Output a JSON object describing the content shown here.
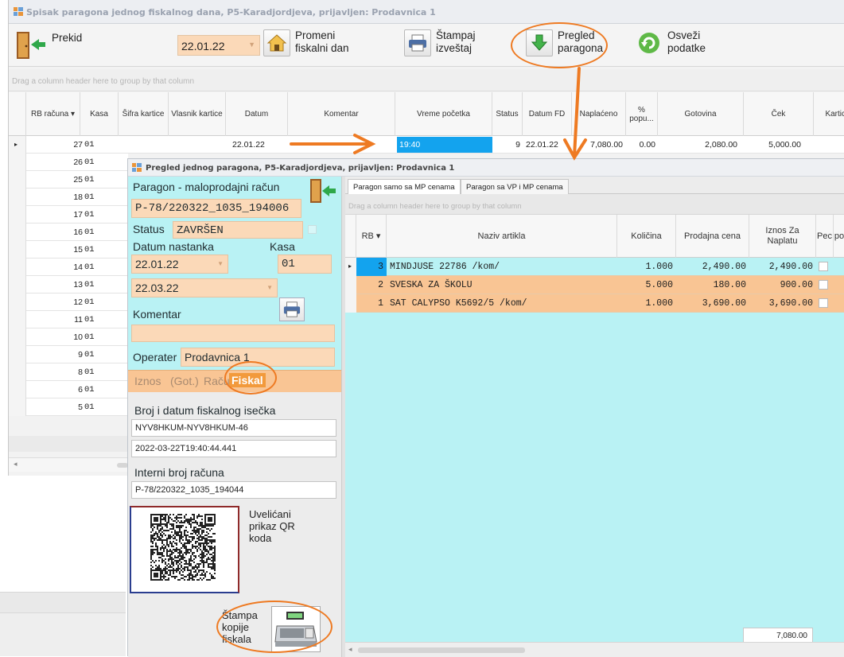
{
  "main_window": {
    "title": "Spisak paragona jednog fiskalnog dana, P5-Karadjordjeva, prijavljen: Prodavnica 1",
    "toolbar": {
      "prekid": "Prekid",
      "date": "22.01.22",
      "promeni_l1": "Promeni",
      "promeni_l2": "fiskalni dan",
      "stampaj_l1": "Štampaj",
      "stampaj_l2": "izveštaj",
      "pregled_l1": "Pregled",
      "pregled_l2": "paragona",
      "osvezi_l1": "Osveži",
      "osvezi_l2": "podatke"
    },
    "group_hint": "Drag a column header here to group by that column",
    "columns": {
      "rb": "RB računa",
      "kasa": "Kasa",
      "sifra": "Šifra kartice",
      "vlasnik": "Vlasnik kartice",
      "datum": "Datum",
      "komentar": "Komentar",
      "vreme": "Vreme početka",
      "status": "Status",
      "datum_fd": "Datum FD",
      "naplaceno": "Naplaćeno",
      "popust": "% popu...",
      "gotovina": "Gotovina",
      "cek": "Ček",
      "kartica": "Kartica"
    },
    "selected_row": {
      "rb": "27",
      "kasa": "01",
      "datum": "22.01.22",
      "vreme": "19:40",
      "status": "9",
      "datum_fd": "22.01.22",
      "naplaceno": "7,080.00",
      "popust": "0.00",
      "gotovina": "2,080.00",
      "cek": "5,000.00"
    },
    "rows": [
      {
        "rb": "26",
        "kasa": "01"
      },
      {
        "rb": "25",
        "kasa": "01"
      },
      {
        "rb": "18",
        "kasa": "01"
      },
      {
        "rb": "17",
        "kasa": "01"
      },
      {
        "rb": "16",
        "kasa": "01"
      },
      {
        "rb": "15",
        "kasa": "01"
      },
      {
        "rb": "14",
        "kasa": "01"
      },
      {
        "rb": "13",
        "kasa": "01"
      },
      {
        "rb": "12",
        "kasa": "01"
      },
      {
        "rb": "11",
        "kasa": "01"
      },
      {
        "rb": "10",
        "kasa": "01"
      },
      {
        "rb": "9",
        "kasa": "01"
      },
      {
        "rb": "8",
        "kasa": "01"
      },
      {
        "rb": "6",
        "kasa": "01"
      },
      {
        "rb": "5",
        "kasa": "01"
      }
    ]
  },
  "dialog": {
    "title": "Pregled jednog paragona, P5-Karadjordjeva, prijavljen: Prodavnica 1",
    "paragon_label": "Paragon - maloprodajni račun",
    "paragon_no": "P-78/220322_1035_194006",
    "status_label": "Status",
    "status_value": "ZAVRŠEN",
    "datum_nastanka_label": "Datum nastanka",
    "kasa_label": "Kasa",
    "datum1": "22.01.22",
    "kasa_value": "01",
    "datum2": "22.03.22",
    "komentar_label": "Komentar",
    "operater_label": "Operater",
    "operater_value": "Prodavnica 1",
    "tabs": {
      "iznos": "Iznos",
      "got": "(Got.)",
      "racun": "Račun",
      "fiskal": "Fiskal"
    },
    "broj_datum_label": "Broj i datum fiskalnog isečka",
    "fiskal_broj": "NYV8HKUM-NYV8HKUM-46",
    "fiskal_datum": "2022-03-22T19:40:44.441",
    "interni_label": "Interni broj računa",
    "interni_value": "P-78/220322_1035_194044",
    "qr_caption": "Uvelićani prikaz QR koda",
    "stampa_l1": "Štampa",
    "stampa_l2": "kopije",
    "stampa_l3": "fiskala",
    "right": {
      "tab1": "Paragon samo sa MP cenama",
      "tab2": "Paragon sa VP i MP cenama",
      "group_hint": "Drag a column header here to group by that column",
      "columns": {
        "rb": "RB",
        "naziv": "Naziv artikla",
        "kolicina": "Količina",
        "prodajna": "Prodajna cena",
        "iznos": "Iznos Za Naplatu",
        "pec": "Pec"
      },
      "items": [
        {
          "rb": "3",
          "naziv": "MINDJUSE 22786 /kom/",
          "kolicina": "1.000",
          "cena": "2,490.00",
          "iznos": "2,490.00"
        },
        {
          "rb": "2",
          "naziv": "SVESKA ZA ŠKOLU",
          "kolicina": "5.000",
          "cena": "180.00",
          "iznos": "900.00"
        },
        {
          "rb": "1",
          "naziv": "SAT CALYPSO K5692/5 /kom/",
          "kolicina": "1.000",
          "cena": "3,690.00",
          "iznos": "3,690.00"
        }
      ],
      "total": "7,080.00"
    }
  },
  "colors": {
    "accent_orange": "#ee7a22",
    "peach": "#fbd9b8",
    "cyan_panel": "#b9f2f4",
    "selection_blue": "#13a3ee"
  }
}
